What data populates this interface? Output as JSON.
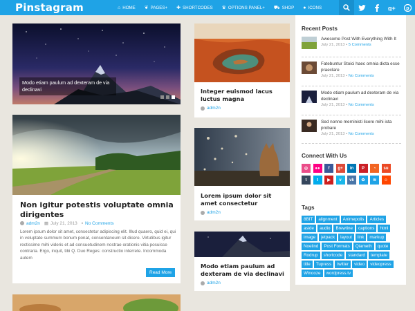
{
  "header": {
    "logo": "Pinstagram",
    "nav": [
      {
        "icon": "home-icon",
        "glyph": "⌂",
        "label": "HOME"
      },
      {
        "icon": "leaf-icon",
        "glyph": "❦",
        "label": "PAGES+"
      },
      {
        "icon": "plus-icon",
        "glyph": "✚",
        "label": "SHORTCODES"
      },
      {
        "icon": "crown-icon",
        "glyph": "♛",
        "label": "OPTIONS PANEL+"
      },
      {
        "icon": "cart-icon",
        "glyph": "⛟",
        "label": "SHOP"
      },
      {
        "icon": "apple-icon",
        "glyph": "●",
        "label": "ICONS"
      }
    ],
    "icons": [
      "search-icon",
      "twitter-icon",
      "facebook-icon",
      "google-plus-icon",
      "pinterest-icon"
    ]
  },
  "slider": {
    "caption": "Modo etiam paulum ad dexteram de via declinavi",
    "slides": 3,
    "active_slide": 3
  },
  "featured_post": {
    "title": "Non igitur potestis voluptate omnia dirigentes",
    "author": "adm2n",
    "date": "July 21, 2013",
    "comments": "No Comments",
    "excerpt": "Lorem ipsum dolor sit amet, consectetur adipiscing elit. Illud quaero, quid ei, qui in voluptate summum bonum ponat, consentaneum sit dicere. Virtutibus igitur rectissime mihi videris et ad consuetudinem nostrae orationis vitia posuisse contraria. Ergo, inquit, tibi Q. Duo Reges: constructio interrete. Incommoda autem",
    "read_more": "Read More"
  },
  "posts": [
    {
      "title": "Integer euismod lacus luctus magna",
      "author": "adm2n"
    },
    {
      "title": "Lorem ipsum dolor sit amet consectetur",
      "author": "adm2n"
    },
    {
      "title": "Modo etiam paulum ad dexteram de via declinavi",
      "author": "adm2n"
    }
  ],
  "sidebar": {
    "recent_title": "Recent Posts",
    "recent": [
      {
        "title": "Awesome Post With Everything With It",
        "date": "July 21, 2013",
        "comments": "5 Comments",
        "sep": " • "
      },
      {
        "title": "Fatebuntur Stoici haec omnia dicta esse praeclare",
        "date": "July 21, 2013",
        "comments": "No Comments",
        "sep": " • "
      },
      {
        "title": "Modo etiam paulum ad dexteram de via declinavi",
        "date": "July 21, 2013",
        "comments": "No Comments",
        "sep": " • "
      },
      {
        "title": "Sed nonne merninisti licere mihi ista probare",
        "date": "July 21, 2013",
        "comments": "No Comments",
        "sep": " • "
      }
    ],
    "connect_title": "Connect With Us",
    "social": [
      {
        "name": "dribbble-icon",
        "glyph": "◎",
        "color": "#ea4c89"
      },
      {
        "name": "flickr-icon",
        "glyph": "●●",
        "color": "#ff0084"
      },
      {
        "name": "facebook-icon",
        "glyph": "f",
        "color": "#3b5998"
      },
      {
        "name": "google-plus-icon",
        "glyph": "g+",
        "color": "#dd4b39"
      },
      {
        "name": "linkedin-icon",
        "glyph": "in",
        "color": "#0077b5"
      },
      {
        "name": "pinterest-icon",
        "glyph": "P",
        "color": "#cb2027"
      },
      {
        "name": "rss-icon",
        "glyph": "◔",
        "color": "#f26522"
      },
      {
        "name": "stumbleupon-icon",
        "glyph": "su",
        "color": "#eb4924"
      },
      {
        "name": "tumblr-icon",
        "glyph": "t",
        "color": "#35465c"
      },
      {
        "name": "twitter-icon",
        "glyph": "t",
        "color": "#00aced"
      },
      {
        "name": "youtube-icon",
        "glyph": "▶",
        "color": "#cd201f"
      },
      {
        "name": "vimeo-icon",
        "glyph": "v",
        "color": "#1ab7ea"
      },
      {
        "name": "vk-icon",
        "glyph": "vk",
        "color": "#4a76a8"
      },
      {
        "name": "envato-icon",
        "glyph": "✿",
        "color": "#1fa3e6"
      },
      {
        "name": "layers-icon",
        "glyph": "≋",
        "color": "#1fa3e6"
      },
      {
        "name": "reddit-icon",
        "glyph": "☺",
        "color": "#ff4500"
      }
    ],
    "tags_title": "Tags",
    "tags": [
      "8BIT",
      "alignment",
      "Animepolis",
      "Articles",
      "aside",
      "audio",
      "Brewtine",
      "captions",
      "html",
      "image",
      "jetpack",
      "layout",
      "link",
      "markup",
      "Noelind",
      "Post Formats",
      "Qiameth",
      "quote",
      "Rodrup",
      "shortcode",
      "standard",
      "template",
      "title",
      "Tupress",
      "twitter",
      "video",
      "videopress",
      "Winooze",
      "wordpress.tv"
    ]
  }
}
